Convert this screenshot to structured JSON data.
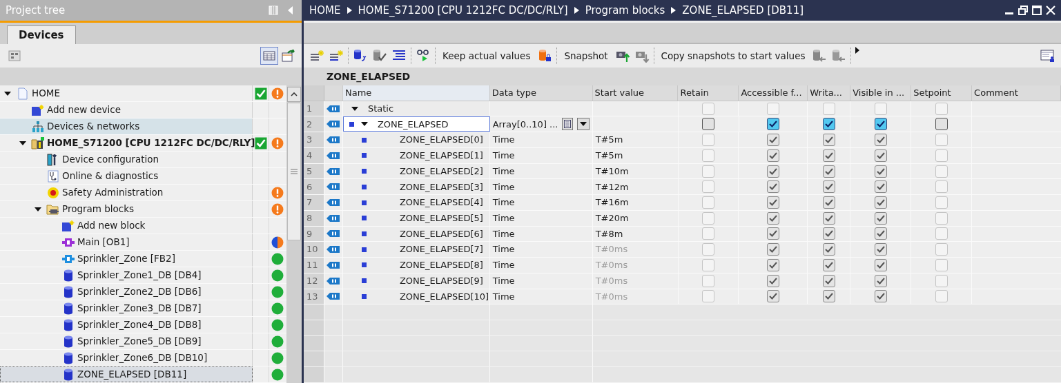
{
  "project_tree": {
    "title": "Project tree",
    "tabs": [
      {
        "label": "Devices",
        "selected": true
      }
    ],
    "items": [
      {
        "label": "HOME",
        "kind": "project",
        "expanded": true,
        "check": true,
        "status": {
          "kind": "warning"
        },
        "selected": false,
        "children": [
          {
            "label": "Add new device",
            "kind": "add",
            "selected": false
          },
          {
            "label": "Devices & networks",
            "kind": "network",
            "selected": false,
            "hovered": true
          },
          {
            "label": "HOME_S71200 [CPU 1212FC DC/DC/RLY]",
            "kind": "device",
            "expanded": true,
            "check": true,
            "status": {
              "kind": "warning"
            },
            "selected": false,
            "children": [
              {
                "label": "Device configuration",
                "kind": "config",
                "selected": false
              },
              {
                "label": "Online & diagnostics",
                "kind": "diagnostics",
                "selected": false
              },
              {
                "label": "Safety Administration",
                "kind": "safety",
                "status": {
                  "kind": "warning"
                },
                "selected": false
              },
              {
                "label": "Program blocks",
                "kind": "folder",
                "expanded": true,
                "status": {
                  "kind": "warning"
                },
                "selected": false,
                "children": [
                  {
                    "label": "Add new block",
                    "kind": "add",
                    "selected": false
                  },
                  {
                    "label": "Main [OB1]",
                    "kind": "ob",
                    "status": {
                      "kind": "mixed"
                    },
                    "selected": false
                  },
                  {
                    "label": "Sprinkler_Zone [FB2]",
                    "kind": "fb",
                    "status": {
                      "kind": "ok"
                    },
                    "selected": false
                  },
                  {
                    "label": "Sprinkler_Zone1_DB [DB4]",
                    "kind": "db",
                    "status": {
                      "kind": "ok"
                    },
                    "selected": false
                  },
                  {
                    "label": "Sprinkler_Zone2_DB [DB6]",
                    "kind": "db",
                    "status": {
                      "kind": "ok"
                    },
                    "selected": false
                  },
                  {
                    "label": "Sprinkler_Zone3_DB [DB7]",
                    "kind": "db",
                    "status": {
                      "kind": "ok"
                    },
                    "selected": false
                  },
                  {
                    "label": "Sprinkler_Zone4_DB [DB8]",
                    "kind": "db",
                    "status": {
                      "kind": "ok"
                    },
                    "selected": false
                  },
                  {
                    "label": "Sprinkler_Zone5_DB [DB9]",
                    "kind": "db",
                    "status": {
                      "kind": "ok"
                    },
                    "selected": false
                  },
                  {
                    "label": "Sprinkler_Zone6_DB [DB10]",
                    "kind": "db",
                    "status": {
                      "kind": "ok"
                    },
                    "selected": false
                  },
                  {
                    "label": "ZONE_ELAPSED [DB11]",
                    "kind": "db",
                    "status": {
                      "kind": "ok"
                    },
                    "selected": true
                  }
                ]
              }
            ]
          }
        ]
      }
    ]
  },
  "editor": {
    "breadcrumb": [
      "HOME",
      "HOME_S71200 [CPU 1212FC DC/DC/RLY]",
      "Program blocks",
      "ZONE_ELAPSED [DB11]"
    ],
    "toolbar": [
      "Keep actual values",
      "Snapshot",
      "Copy snapshots to start values"
    ],
    "block_title": "ZONE_ELAPSED",
    "table": {
      "columns": [
        "Name",
        "Data type",
        "Start value",
        "Retain",
        "Accessible f...",
        "Writa...",
        "Visible in ...",
        "Setpoint",
        "Comment"
      ],
      "rows": [
        {
          "number": "1",
          "name": "Static",
          "expanded": true,
          "selected": false,
          "checks": [
            {
              "checked": false,
              "disabled": true
            },
            {
              "checked": false,
              "disabled": true
            },
            {
              "checked": false,
              "disabled": true
            },
            {
              "checked": false,
              "disabled": true
            },
            {
              "checked": false,
              "disabled": true
            }
          ],
          "children": [
            {
              "number": "2",
              "name": "ZONE_ELAPSED",
              "data_type": "Array[0..10] ...",
              "expanded": true,
              "selected": true,
              "checks": [
                {
                  "checked": false,
                  "disabled": false
                },
                {
                  "checked": true,
                  "disabled": false
                },
                {
                  "checked": true,
                  "disabled": false
                },
                {
                  "checked": true,
                  "disabled": false
                },
                {
                  "checked": false,
                  "disabled": false
                }
              ],
              "children": [
                {
                  "number": "3",
                  "name": "ZONE_ELAPSED[0]",
                  "data_type": "Time",
                  "start_value": "T#5m",
                  "default": false,
                  "selected": false,
                  "checks": [
                    {
                      "checked": false,
                      "disabled": true
                    },
                    {
                      "checked": true,
                      "disabled": true
                    },
                    {
                      "checked": true,
                      "disabled": true
                    },
                    {
                      "checked": true,
                      "disabled": true
                    },
                    {
                      "checked": false,
                      "disabled": true
                    }
                  ]
                },
                {
                  "number": "4",
                  "name": "ZONE_ELAPSED[1]",
                  "data_type": "Time",
                  "start_value": "T#5m",
                  "default": false,
                  "selected": false,
                  "checks": [
                    {
                      "checked": false,
                      "disabled": true
                    },
                    {
                      "checked": true,
                      "disabled": true
                    },
                    {
                      "checked": true,
                      "disabled": true
                    },
                    {
                      "checked": true,
                      "disabled": true
                    },
                    {
                      "checked": false,
                      "disabled": true
                    }
                  ]
                },
                {
                  "number": "5",
                  "name": "ZONE_ELAPSED[2]",
                  "data_type": "Time",
                  "start_value": "T#10m",
                  "default": false,
                  "selected": false,
                  "checks": [
                    {
                      "checked": false,
                      "disabled": true
                    },
                    {
                      "checked": true,
                      "disabled": true
                    },
                    {
                      "checked": true,
                      "disabled": true
                    },
                    {
                      "checked": true,
                      "disabled": true
                    },
                    {
                      "checked": false,
                      "disabled": true
                    }
                  ]
                },
                {
                  "number": "6",
                  "name": "ZONE_ELAPSED[3]",
                  "data_type": "Time",
                  "start_value": "T#12m",
                  "default": false,
                  "selected": false,
                  "checks": [
                    {
                      "checked": false,
                      "disabled": true
                    },
                    {
                      "checked": true,
                      "disabled": true
                    },
                    {
                      "checked": true,
                      "disabled": true
                    },
                    {
                      "checked": true,
                      "disabled": true
                    },
                    {
                      "checked": false,
                      "disabled": true
                    }
                  ]
                },
                {
                  "number": "7",
                  "name": "ZONE_ELAPSED[4]",
                  "data_type": "Time",
                  "start_value": "T#16m",
                  "default": false,
                  "selected": false,
                  "checks": [
                    {
                      "checked": false,
                      "disabled": true
                    },
                    {
                      "checked": true,
                      "disabled": true
                    },
                    {
                      "checked": true,
                      "disabled": true
                    },
                    {
                      "checked": true,
                      "disabled": true
                    },
                    {
                      "checked": false,
                      "disabled": true
                    }
                  ]
                },
                {
                  "number": "8",
                  "name": "ZONE_ELAPSED[5]",
                  "data_type": "Time",
                  "start_value": "T#20m",
                  "default": false,
                  "selected": false,
                  "checks": [
                    {
                      "checked": false,
                      "disabled": true
                    },
                    {
                      "checked": true,
                      "disabled": true
                    },
                    {
                      "checked": true,
                      "disabled": true
                    },
                    {
                      "checked": true,
                      "disabled": true
                    },
                    {
                      "checked": false,
                      "disabled": true
                    }
                  ]
                },
                {
                  "number": "9",
                  "name": "ZONE_ELAPSED[6]",
                  "data_type": "Time",
                  "start_value": "T#8m",
                  "default": false,
                  "selected": false,
                  "checks": [
                    {
                      "checked": false,
                      "disabled": true
                    },
                    {
                      "checked": true,
                      "disabled": true
                    },
                    {
                      "checked": true,
                      "disabled": true
                    },
                    {
                      "checked": true,
                      "disabled": true
                    },
                    {
                      "checked": false,
                      "disabled": true
                    }
                  ]
                },
                {
                  "number": "10",
                  "name": "ZONE_ELAPSED[7]",
                  "data_type": "Time",
                  "start_value": "T#0ms",
                  "default": true,
                  "selected": false,
                  "checks": [
                    {
                      "checked": false,
                      "disabled": true
                    },
                    {
                      "checked": true,
                      "disabled": true
                    },
                    {
                      "checked": true,
                      "disabled": true
                    },
                    {
                      "checked": true,
                      "disabled": true
                    },
                    {
                      "checked": false,
                      "disabled": true
                    }
                  ]
                },
                {
                  "number": "11",
                  "name": "ZONE_ELAPSED[8]",
                  "data_type": "Time",
                  "start_value": "T#0ms",
                  "default": true,
                  "selected": false,
                  "checks": [
                    {
                      "checked": false,
                      "disabled": true
                    },
                    {
                      "checked": true,
                      "disabled": true
                    },
                    {
                      "checked": true,
                      "disabled": true
                    },
                    {
                      "checked": true,
                      "disabled": true
                    },
                    {
                      "checked": false,
                      "disabled": true
                    }
                  ]
                },
                {
                  "number": "12",
                  "name": "ZONE_ELAPSED[9]",
                  "data_type": "Time",
                  "start_value": "T#0ms",
                  "default": true,
                  "selected": false,
                  "checks": [
                    {
                      "checked": false,
                      "disabled": true
                    },
                    {
                      "checked": true,
                      "disabled": true
                    },
                    {
                      "checked": true,
                      "disabled": true
                    },
                    {
                      "checked": true,
                      "disabled": true
                    },
                    {
                      "checked": false,
                      "disabled": true
                    }
                  ]
                },
                {
                  "number": "13",
                  "name": "ZONE_ELAPSED[10]",
                  "data_type": "Time",
                  "start_value": "T#0ms",
                  "default": true,
                  "selected": false,
                  "checks": [
                    {
                      "checked": false,
                      "disabled": true
                    },
                    {
                      "checked": true,
                      "disabled": true
                    },
                    {
                      "checked": true,
                      "disabled": true
                    },
                    {
                      "checked": true,
                      "disabled": true
                    },
                    {
                      "checked": false,
                      "disabled": true
                    }
                  ]
                }
              ]
            }
          ]
        }
      ]
    }
  }
}
